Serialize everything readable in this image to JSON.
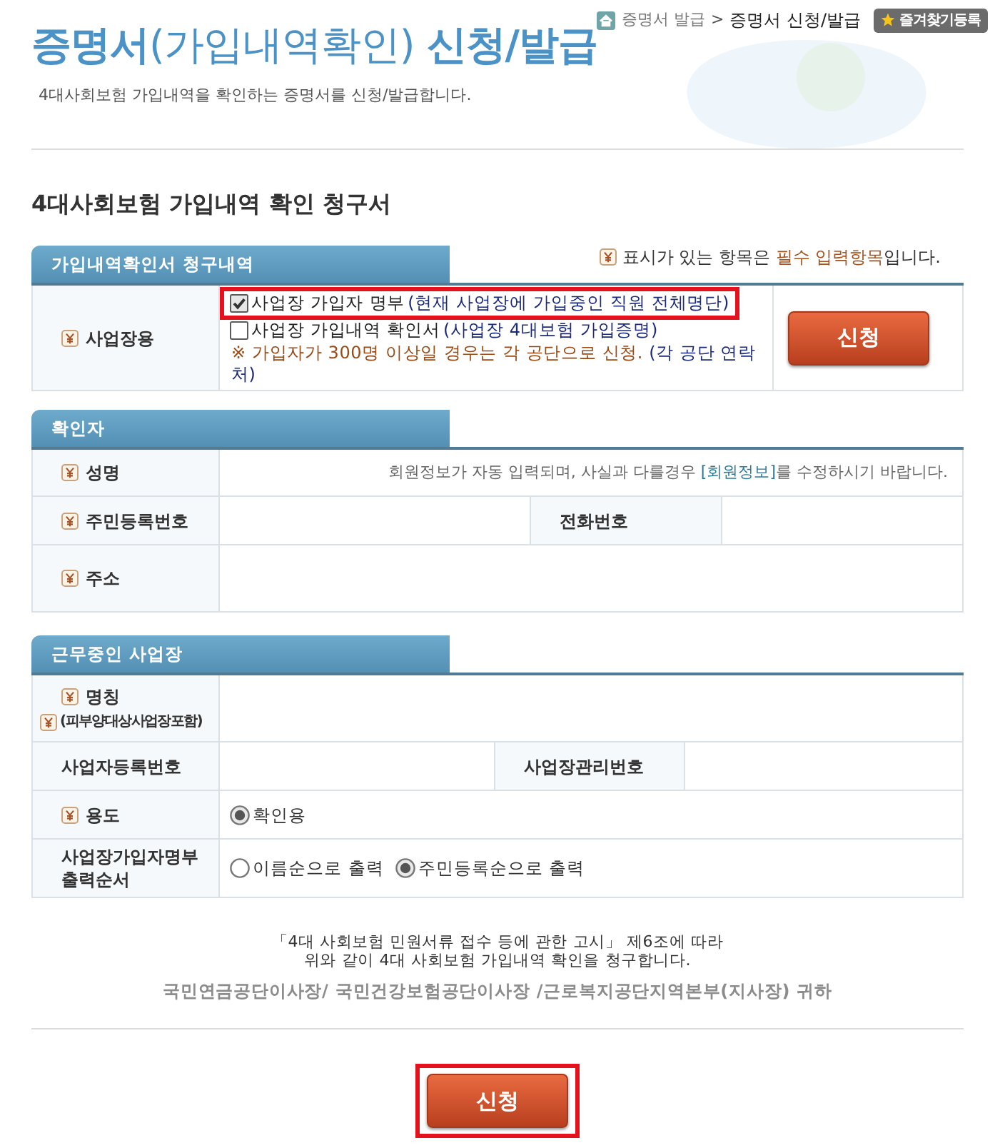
{
  "breadcrumb": {
    "items": [
      {
        "label": "증명서 발급",
        "selected": false
      },
      {
        "label": "증명서 신청/발급",
        "selected": true
      }
    ],
    "separator": ">",
    "favorite_button": "즐겨찾기등록"
  },
  "header": {
    "title": "**증명서**(가입내역확인) **신청/발급**",
    "subtitle": "4대사회보험 가입내역을 확인하는 증명서를 신청/발급합니다."
  },
  "form_title": "4대사회보험 가입내역 확인 청구서",
  "required_note": {
    "before": "표시가 있는 항목은 ",
    "emphasis": "필수 입력항목",
    "after": "입니다."
  },
  "sections": [
    {
      "kind": "request",
      "tab": "가입내역확인서 청구내역",
      "rows": [
        {
          "cells": [
            {
              "kind": "label",
              "text": "사업장용",
              "required": true
            },
            {
              "kind": "checks",
              "options": [
                {
                  "label": "사업장 가입자 명부",
                  "detail": "(현재 사업장에 가입중인 직원 전체명단)",
                  "checked": true,
                  "highlighted": true
                },
                {
                  "label": "사업장 가입내역 확인서",
                  "detail": "(사업장 4대보험 가입증명)",
                  "checked": false,
                  "highlighted": false
                }
              ],
              "notice": {
                "warning": "※ 가입자가 300명 이상일 경우는 각 공단으로 신청.",
                "contact": "(각 공단 연락처)"
              }
            },
            {
              "kind": "button",
              "label": "신청",
              "highlighted": false
            }
          ]
        }
      ]
    },
    {
      "kind": "applicant",
      "tab": "확인자",
      "rows": [
        {
          "cells": [
            {
              "kind": "label",
              "text": "성명",
              "required": true
            },
            {
              "kind": "field_note",
              "note": {
                "before": "회원정보가 자동 입력되며, 사실과 다를경우 ",
                "link": "[회원정보]",
                "after": "를 수정하시기 바랍니다."
              }
            }
          ]
        },
        {
          "cells": [
            {
              "kind": "label",
              "text": "주민등록번호",
              "required": true
            },
            {
              "kind": "field"
            },
            {
              "kind": "label",
              "text": "전화번호",
              "required": false
            },
            {
              "kind": "field"
            }
          ]
        },
        {
          "cells": [
            {
              "kind": "label",
              "text": "주소",
              "required": true
            },
            {
              "kind": "textarea"
            }
          ]
        }
      ]
    },
    {
      "kind": "workplace",
      "tab": "근무중인 사업장",
      "rows": [
        {
          "cells": [
            {
              "kind": "label",
              "text": "명칭",
              "required": true,
              "sub": {
                "text": "(피부양대상사업장포함)",
                "required": true
              }
            },
            {
              "kind": "textarea"
            }
          ]
        },
        {
          "cells": [
            {
              "kind": "label",
              "text": "사업자등록번호",
              "required": false
            },
            {
              "kind": "field"
            },
            {
              "kind": "label",
              "text": "사업장관리번호",
              "required": false
            },
            {
              "kind": "field"
            }
          ]
        },
        {
          "cells": [
            {
              "kind": "label",
              "text": "용도",
              "required": true
            },
            {
              "kind": "radios",
              "options": [
                {
                  "label": "확인용",
                  "selected": true
                }
              ]
            }
          ]
        },
        {
          "cells": [
            {
              "kind": "label",
              "text": "사업장가입자명부 출력순서",
              "required": false
            },
            {
              "kind": "radios",
              "options": [
                {
                  "label": "이름순으로 출력",
                  "selected": false
                },
                {
                  "label": "주민등록순으로 출력",
                  "selected": true
                }
              ]
            }
          ]
        }
      ]
    }
  ],
  "footer": {
    "legal": [
      "「4대 사회보험 민원서류 접수 등에 관한 고시」 제6조에 따라",
      "위와 같이 4대 사회보험 가입내역 확인을 청구합니다."
    ],
    "addressee": "국민연금공단이사장/ 국민건강보험공단이사장 /근로복지공단지역본부(지사장) 귀하",
    "submit": {
      "label": "신청",
      "highlighted": true
    }
  }
}
